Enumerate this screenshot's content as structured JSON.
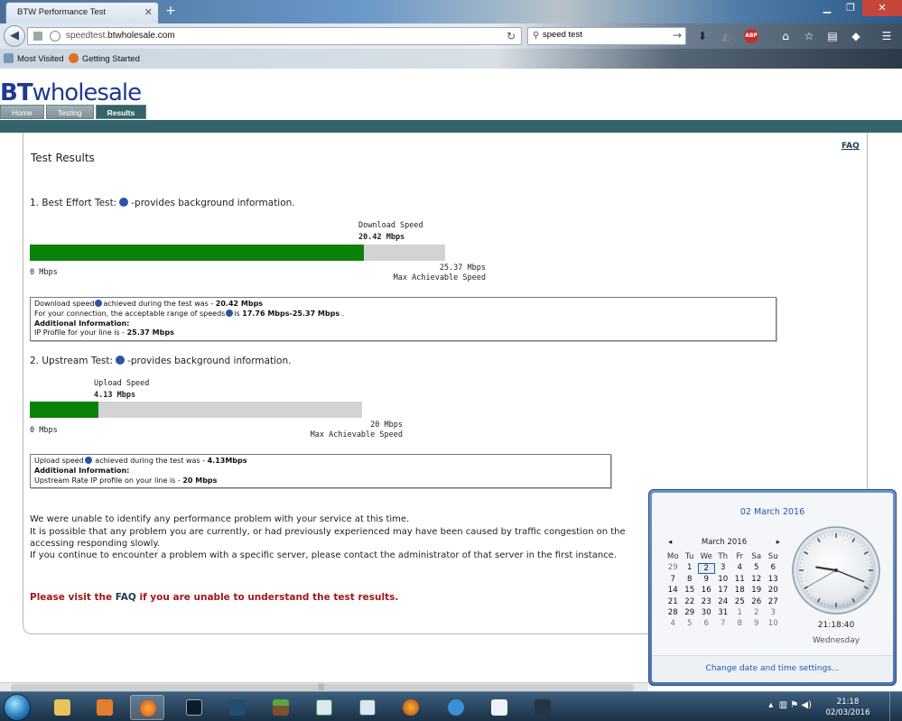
{
  "browser": {
    "tab_title": "BTW Performance Test",
    "url_prefix": "speedtest.",
    "url_domain": "btwholesale.com",
    "search_value": "speed test",
    "bookmarks": [
      "Most Visited",
      "Getting Started"
    ]
  },
  "page": {
    "logo_bt": "BT",
    "logo_rest": "wholesale",
    "nav_tabs": [
      "Home",
      "Testing",
      "Results"
    ],
    "faq_link": "FAQ",
    "title": "Test Results",
    "download": {
      "section_title": "1. Best Effort Test:",
      "section_suffix": "-provides background information.",
      "speed_label": "Download Speed",
      "speed_value": "20.42 Mbps",
      "speed_mbps": 20.42,
      "max_mbps": 25.37,
      "min_label": "0 Mbps",
      "max_label": "25.37 Mbps",
      "max_caption": "Max Achievable Speed",
      "info_line1_a": "Download speed",
      "info_line1_b": "achieved during the test was - ",
      "info_line1_value": "20.42 Mbps",
      "info_line2_a": "For your connection, the acceptable range of speeds",
      "info_line2_b": "is ",
      "info_line2_value": "17.76 Mbps-25.37 Mbps",
      "info_line2_end": " .",
      "additional_info": "Additional Information:",
      "info_line4_a": "IP Profile for your line is - ",
      "info_line4_value": "25.37 Mbps"
    },
    "upload": {
      "section_title": "2. Upstream Test:",
      "section_suffix": "-provides background information.",
      "speed_label": "Upload Speed",
      "speed_value": "4.13 Mbps",
      "speed_mbps": 4.13,
      "max_mbps": 20,
      "min_label": "0 Mbps",
      "max_label": "20 Mbps",
      "max_caption": "Max Achievable Speed",
      "info_line1_a": "Upload speed",
      "info_line1_b": " achieved during the test was - ",
      "info_line1_value": "4.13Mbps",
      "additional_info": "Additional Information:",
      "info_line3_a": "Upstream Rate IP profile on your line is - ",
      "info_line3_value": "20 Mbps"
    },
    "message_line1": "We were unable to identify any performance problem with your service at this time.",
    "message_line2": "It is possible that any problem you are currently, or had previously experienced may have been caused by traffic congestion on the",
    "message_line3": "accessing responding slowly.",
    "message_line4": "If you continue to encounter a problem with a specific server, please contact the administrator of that server in the first instance.",
    "please_visit_a": "Please visit the ",
    "please_visit_link": "FAQ",
    "please_visit_b": " if you are unable to understand the test results."
  },
  "clock_flyout": {
    "full_date": "02 March 2016",
    "month_year": "March 2016",
    "day_headers": [
      "Mo",
      "Tu",
      "We",
      "Th",
      "Fr",
      "Sa",
      "Su"
    ],
    "weeks": [
      [
        "29",
        "1",
        "2",
        "3",
        "4",
        "5",
        "6"
      ],
      [
        "7",
        "8",
        "9",
        "10",
        "11",
        "12",
        "13"
      ],
      [
        "14",
        "15",
        "16",
        "17",
        "18",
        "19",
        "20"
      ],
      [
        "21",
        "22",
        "23",
        "24",
        "25",
        "26",
        "27"
      ],
      [
        "28",
        "29",
        "30",
        "31",
        "1",
        "2",
        "3"
      ],
      [
        "4",
        "5",
        "6",
        "7",
        "8",
        "9",
        "10"
      ]
    ],
    "time": "21:18:40",
    "day_name": "Wednesday",
    "change_link": "Change date and time settings...",
    "clock_hours": 21,
    "clock_minutes": 18,
    "clock_seconds": 40
  },
  "taskbar": {
    "time": "21:18",
    "date": "02/03/2016"
  },
  "colors": {
    "bar_fill": "#0a820a",
    "bar_track": "#d3d3d3",
    "accent_teal": "#33646a",
    "logo_blue": "#1d3a92",
    "warning_red": "#a11818"
  }
}
